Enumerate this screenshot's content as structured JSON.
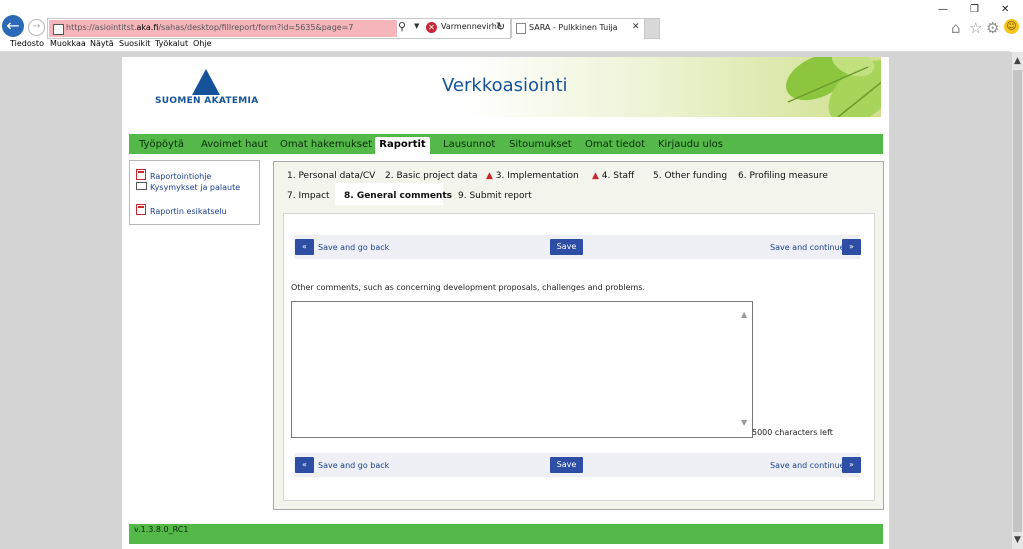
{
  "browser": {
    "url_prefix": "https://asiointitst.",
    "url_host": "aka.fi",
    "url_path": "/sahas/desktop/fillreport/form?id=5635&page=7",
    "cert_error": "Varmennevirhe",
    "tab_title": "SARA - Pulkkinen Tuija",
    "menu": [
      "Tiedosto",
      "Muokkaa",
      "Näytä",
      "Suosikit",
      "Työkalut",
      "Ohje"
    ]
  },
  "banner": {
    "logo_text": "SUOMEN AKATEMIA",
    "title": "Verkkoasiointi"
  },
  "nav": {
    "items": [
      "Työpöytä",
      "Avoimet haut",
      "Omat hakemukset",
      "Raportit",
      "Lausunnot",
      "Sitoumukset",
      "Omat tiedot",
      "Kirjaudu ulos"
    ],
    "active": "Raportit"
  },
  "sidebar": {
    "links": [
      "Raportointiohje",
      "Kysymykset ja palaute",
      "Raportin esikatselu"
    ]
  },
  "steps": [
    "1. Personal data/CV",
    "2. Basic project data",
    "3. Implementation",
    "4. Staff",
    "5. Other funding",
    "6. Profiling measure",
    "7. Impact",
    "8. General comments",
    "9. Submit report"
  ],
  "actions": {
    "back_arrow": "«",
    "back_label": "Save and go back",
    "save_label": "Save",
    "continue_label": "Save and continue",
    "continue_arrow": "»"
  },
  "form": {
    "prompt": "Other comments, such as concerning development proposals, challenges and problems.",
    "value": "",
    "chars_left": "5000 characters left"
  },
  "footer": {
    "version": "v.1.3.8.0_RC1"
  },
  "colors": {
    "nav_green": "#54b948",
    "brand_blue": "#14539a",
    "button_blue": "#2e4da4",
    "address_error_pink": "#f5b6bb"
  }
}
